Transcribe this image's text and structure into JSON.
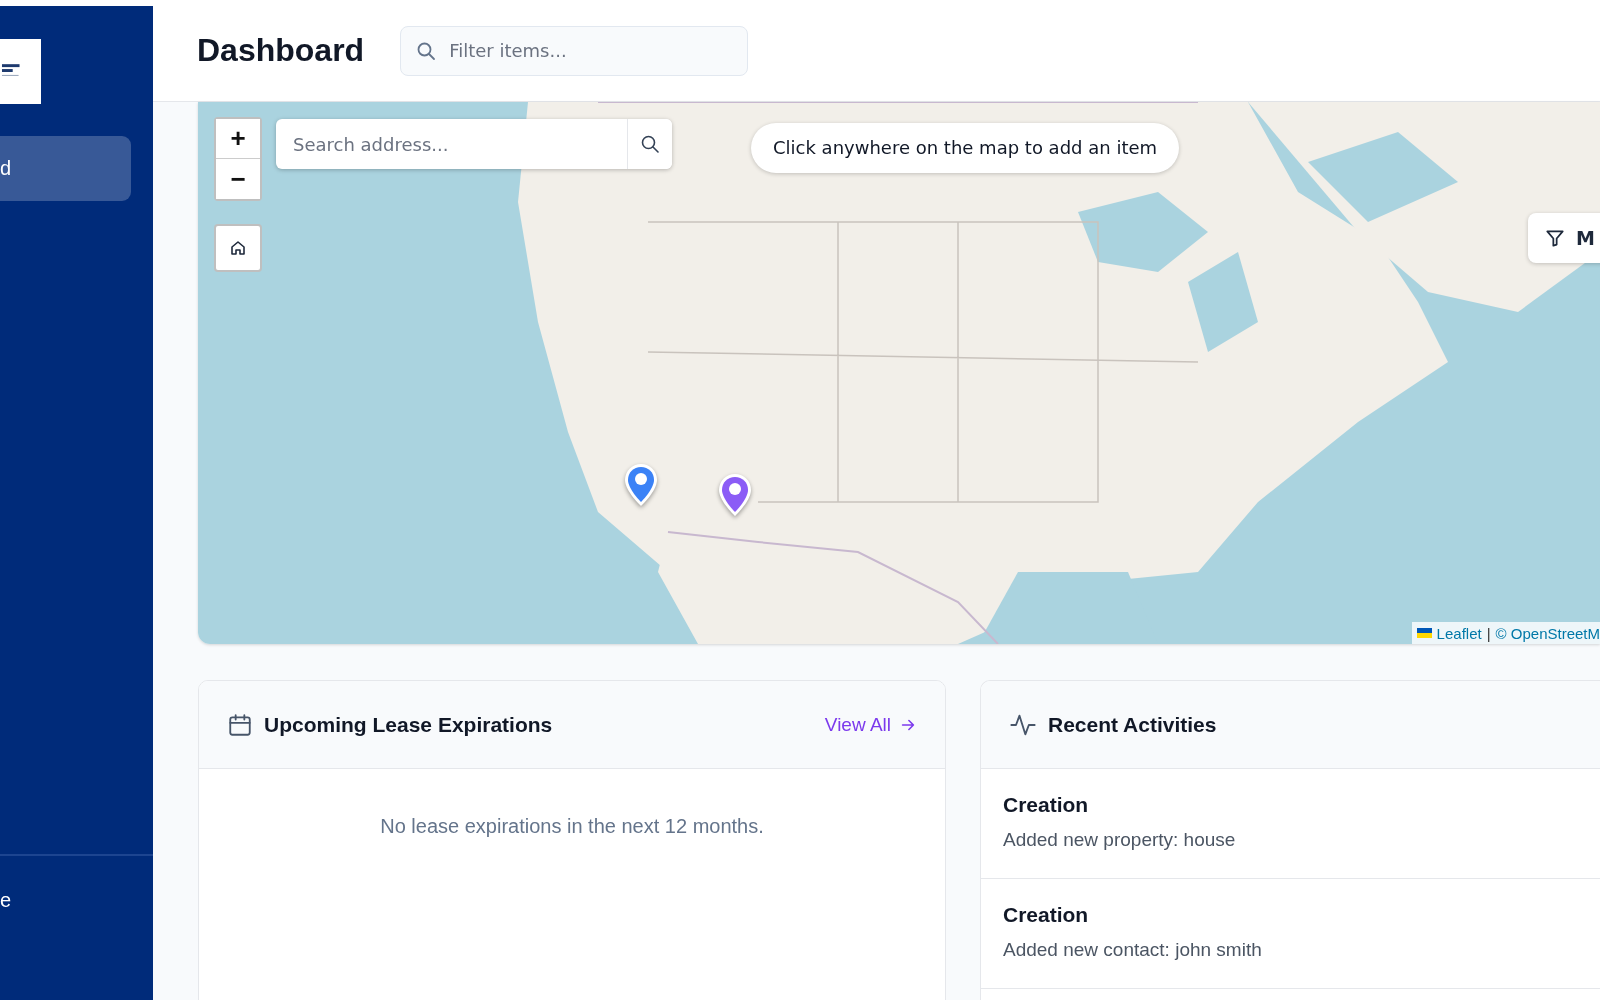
{
  "sidebar": {
    "items": [
      {
        "label": "d",
        "selected": true
      }
    ],
    "footer_items": [
      {
        "label": "e"
      }
    ]
  },
  "header": {
    "title": "Dashboard",
    "filter": {
      "placeholder": "Filter items..."
    }
  },
  "map": {
    "kind": "picture",
    "search": {
      "placeholder": "Search address..."
    },
    "zoom_in": "+",
    "zoom_out": "−",
    "hint": "Click anywhere on the map to add an item",
    "filter_button": "M",
    "markers": [
      {
        "color": "#3b82f6"
      },
      {
        "color": "#8b5cf6"
      }
    ],
    "attribution": {
      "link": "Leaflet",
      "separator": "|",
      "copyright": "© OpenStreetM"
    }
  },
  "lease_card": {
    "title": "Upcoming Lease Expirations",
    "view_all": "View All",
    "empty": "No lease expirations in the next 12 months."
  },
  "activity_card": {
    "title": "Recent Activities",
    "items": [
      {
        "title": "Creation",
        "text": "Added new property: house"
      },
      {
        "title": "Creation",
        "text": "Added new contact: john smith"
      }
    ]
  }
}
